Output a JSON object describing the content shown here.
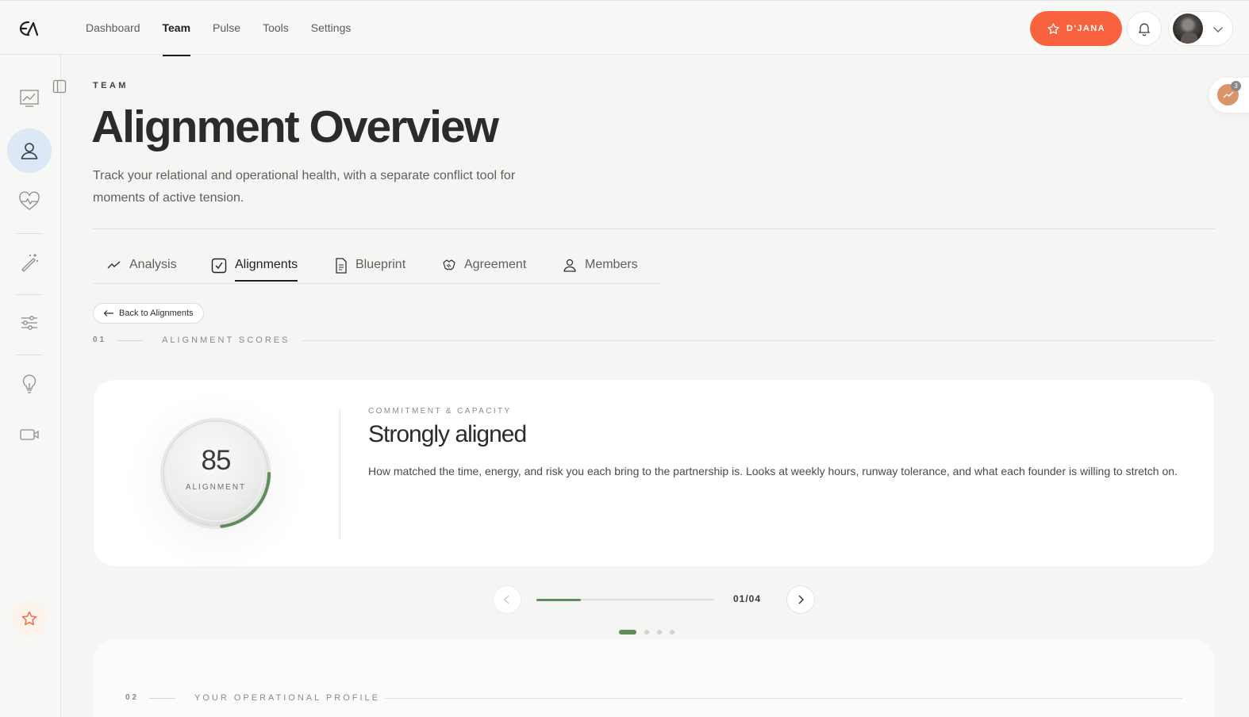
{
  "nav": {
    "items": [
      {
        "label": "Dashboard",
        "active": false
      },
      {
        "label": "Team",
        "active": true
      },
      {
        "label": "Pulse",
        "active": false
      },
      {
        "label": "Tools",
        "active": false
      },
      {
        "label": "Settings",
        "active": false
      }
    ]
  },
  "header": {
    "user_button_label": "D'JANA",
    "accent_color": "#f9623e"
  },
  "sidebar": {
    "icons": [
      "chart-line-icon",
      "user-icon",
      "heart-pulse-icon",
      "magic-wand-icon",
      "sliders-icon",
      "lightbulb-icon",
      "video-icon"
    ],
    "active": "user-icon"
  },
  "page": {
    "eyebrow": "TEAM",
    "title": "Alignment Overview",
    "subtitle": "Track your relational and operational health, with a separate conflict tool for moments of active tension."
  },
  "tabs": [
    {
      "label": "Analysis",
      "icon": "trend-icon"
    },
    {
      "label": "Alignments",
      "icon": "checkbox-icon",
      "active": true
    },
    {
      "label": "Blueprint",
      "icon": "document-icon"
    },
    {
      "label": "Agreement",
      "icon": "handshake-icon"
    },
    {
      "label": "Members",
      "icon": "person-icon"
    }
  ],
  "back_button": "Back to Alignments",
  "section1": {
    "number": "01",
    "label": "ALIGNMENT SCORES"
  },
  "score_card": {
    "score": "85",
    "score_value": 85,
    "score_label": "ALIGNMENT",
    "category": "COMMITMENT & CAPACITY",
    "title": "Strongly aligned",
    "description": "How matched the time, energy, and risk you each bring to the partnership is. Looks at weekly hours, runway tolerance, and what each founder is willing to stretch on.",
    "gauge_color": "#5e8c5c"
  },
  "pager": {
    "count": "01/04",
    "progress": 0.25,
    "total_dots": 4,
    "active_dot": 0
  },
  "section2": {
    "number": "02",
    "label": "YOUR OPERATIONAL PROFILE"
  },
  "float_badge": {
    "count": "3"
  }
}
